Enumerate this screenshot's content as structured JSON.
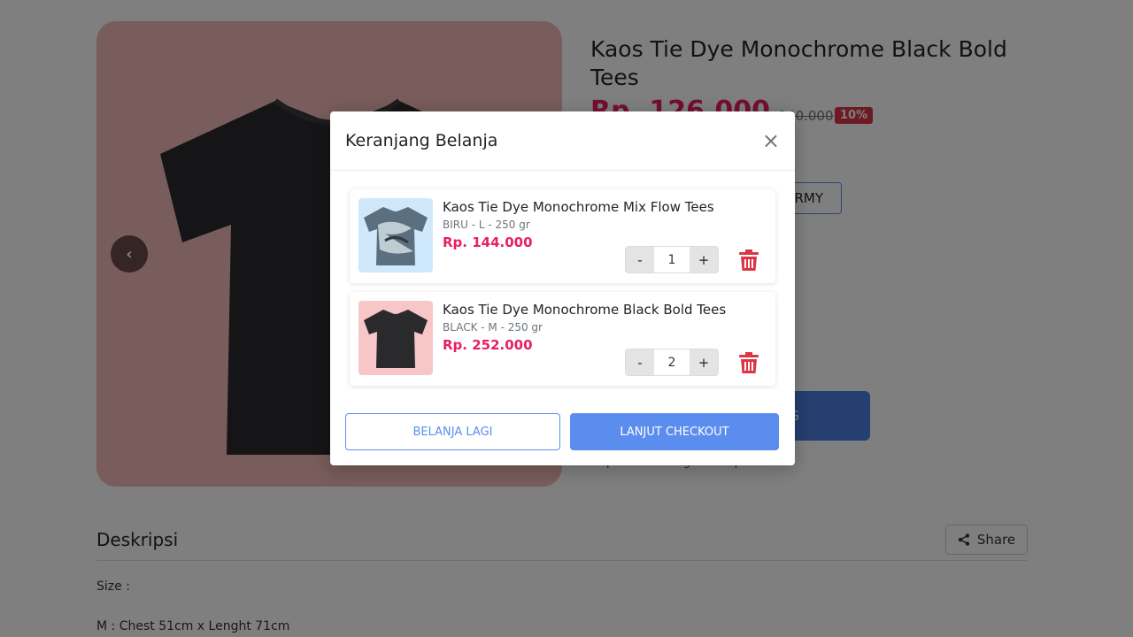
{
  "product": {
    "title": "Kaos Tie Dye Monochrome Black Bold Tees",
    "price": "Rp. 126.000",
    "old_price": "Rp. 140.000",
    "discount": "10%",
    "variant_label": "ARMY",
    "cart_button_label": "G",
    "note": "Dapatkan barang sesuai pesanan"
  },
  "description": {
    "title": "Deskripsi",
    "share_label": "Share",
    "lines": [
      "Size :",
      "M : Chest 51cm x Lenght 71cm"
    ]
  },
  "modal": {
    "title": "Keranjang Belanja",
    "close_symbol": "×",
    "items": [
      {
        "name": "Kaos Tie Dye Monochrome Mix Flow Tees",
        "variant": "BIRU - L - 250 gr",
        "price": "Rp. 144.000",
        "qty": "1",
        "thumb_bg": "#cfe8fb"
      },
      {
        "name": "Kaos Tie Dye Monochrome Black Bold Tees",
        "variant": "BLACK - M - 250 gr",
        "price": "Rp. 252.000",
        "qty": "2",
        "thumb_bg": "#f7c6c6"
      }
    ],
    "minus": "-",
    "plus": "+",
    "continue_label": "BELANJA LAGI",
    "checkout_label": "LANJUT CHECKOUT"
  },
  "colors": {
    "accent": "#5b8def",
    "price": "#e91e63",
    "danger": "#dc3545",
    "gallery_bg": "#f3b9b9"
  },
  "icons": [
    "chevron-left-icon",
    "close-icon",
    "trash-icon",
    "share-icon"
  ]
}
